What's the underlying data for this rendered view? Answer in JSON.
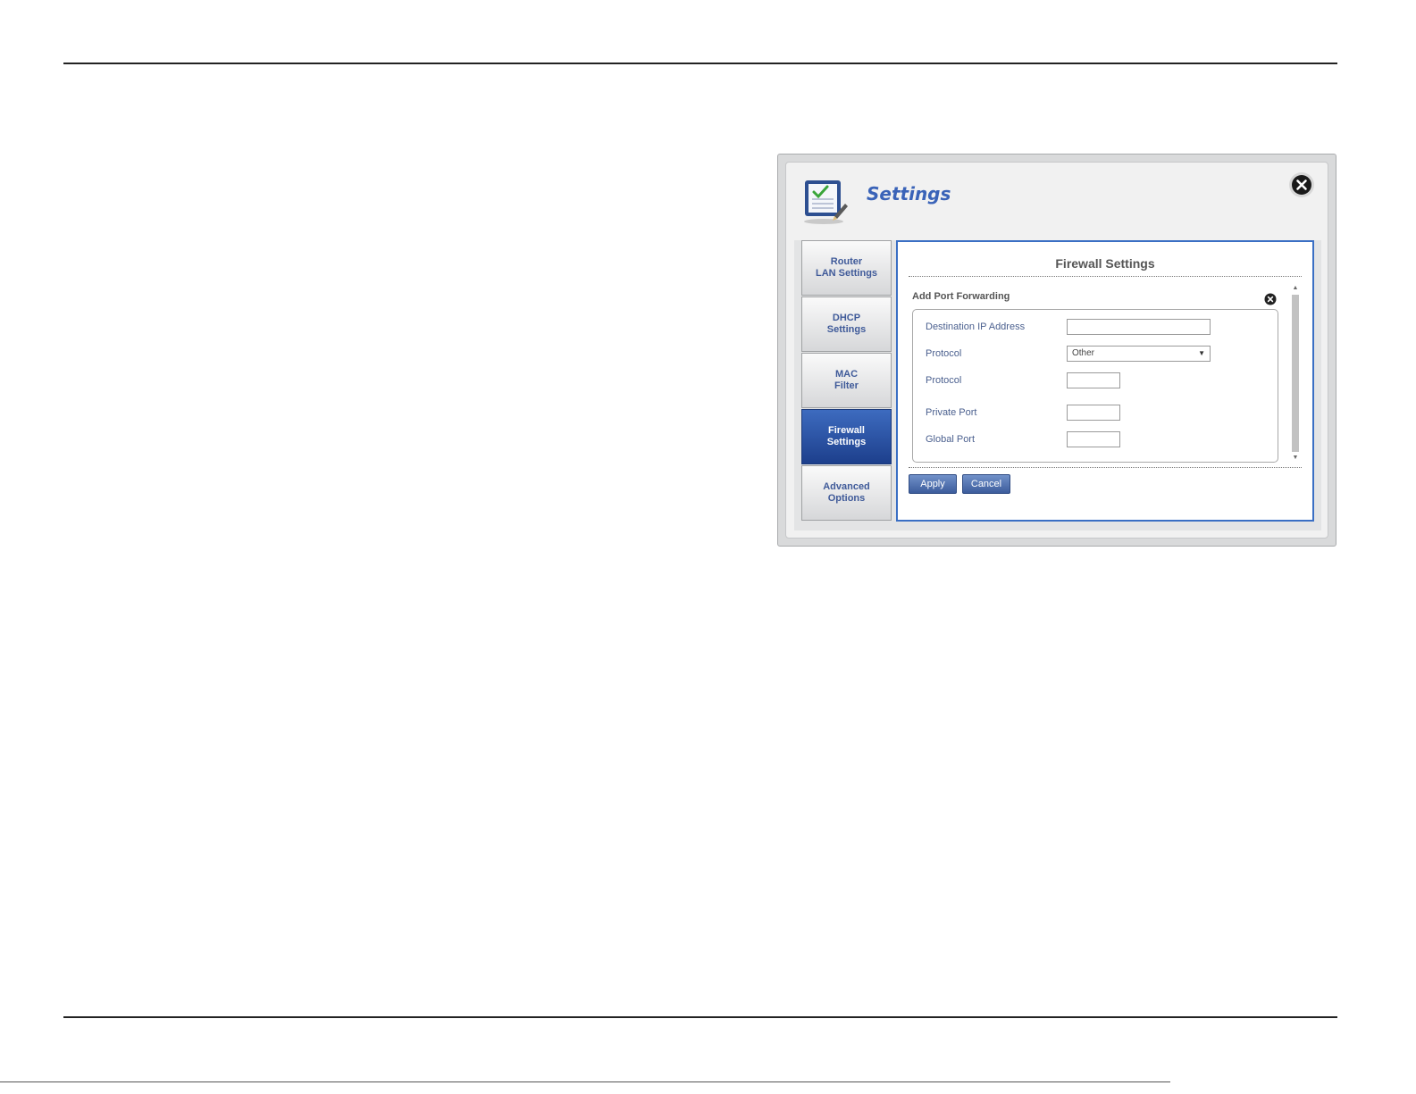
{
  "dialog": {
    "title": "Settings"
  },
  "nav": {
    "items": [
      {
        "label": "Router\nLAN Settings",
        "active": false
      },
      {
        "label": "DHCP\nSettings",
        "active": false
      },
      {
        "label": "MAC\nFilter",
        "active": false
      },
      {
        "label": "Firewall\nSettings",
        "active": true
      },
      {
        "label": "Advanced\nOptions",
        "active": false
      }
    ]
  },
  "panel": {
    "title": "Firewall Settings",
    "section_title": "Add Port Forwarding",
    "fields": {
      "dest_ip_label": "Destination IP Address",
      "dest_ip_value": "",
      "protocol_label": "Protocol",
      "protocol_selected": "Other",
      "protocol_number_label": "Protocol",
      "protocol_number_value": "",
      "private_port_label": "Private Port",
      "private_port_value": "",
      "global_port_label": "Global Port",
      "global_port_value": ""
    },
    "apply_label": "Apply",
    "cancel_label": "Cancel"
  },
  "colors": {
    "accent": "#3a6fc4",
    "title_blue": "#3a63b8",
    "active_nav": "#1d3f8c"
  },
  "icons": {
    "dialog_icon": "settings-checklist-icon",
    "close": "close-icon",
    "dropdown": "chevron-down-icon"
  }
}
